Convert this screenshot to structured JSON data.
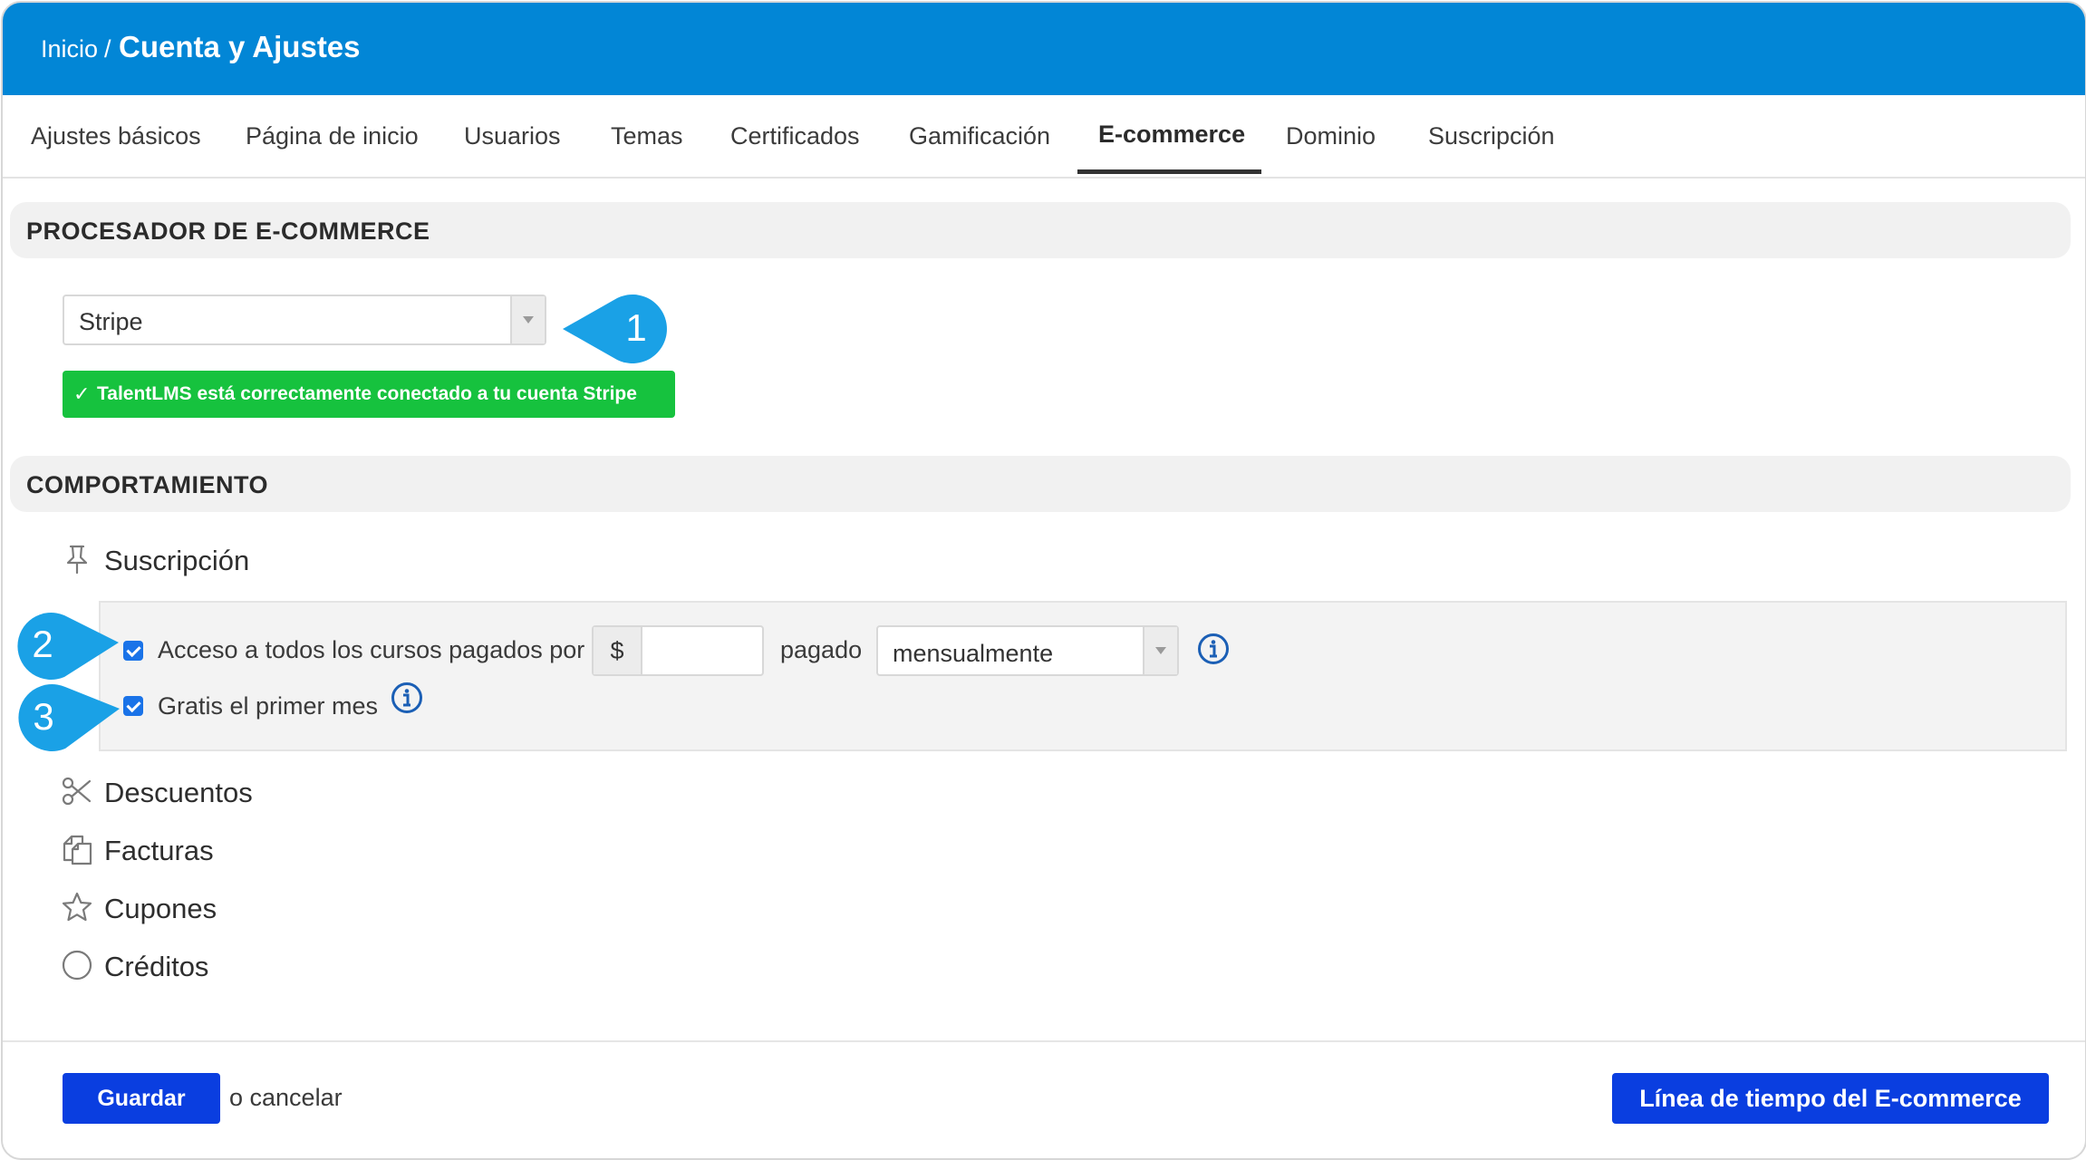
{
  "header": {
    "breadcrumb_home": "Inicio",
    "breadcrumb_sep": "/",
    "page_title": "Cuenta y Ajustes"
  },
  "tabs": [
    {
      "label": "Ajustes básicos"
    },
    {
      "label": "Página de inicio"
    },
    {
      "label": "Usuarios"
    },
    {
      "label": "Temas"
    },
    {
      "label": "Certificados"
    },
    {
      "label": "Gamificación"
    },
    {
      "label": "E-commerce",
      "active": true
    },
    {
      "label": "Dominio"
    },
    {
      "label": "Suscripción"
    }
  ],
  "processor": {
    "section_title": "PROCESADOR DE E-COMMERCE",
    "selected": "Stripe",
    "status_text": "TalentLMS está correctamente conectado a tu cuenta Stripe",
    "status_icon": "check-icon"
  },
  "behavior": {
    "section_title": "COMPORTAMIENTO",
    "subscription": {
      "label": "Suscripción",
      "icon": "pin-icon",
      "access_label": "Acceso a todos los cursos pagados por",
      "access_checked": true,
      "currency_symbol": "$",
      "amount_value": "",
      "paid_label": "pagado",
      "period_selected": "mensualmente",
      "free_month_label": "Gratis el primer mes",
      "free_month_checked": true
    },
    "items": [
      {
        "label": "Descuentos",
        "icon": "scissors-icon"
      },
      {
        "label": "Facturas",
        "icon": "invoices-icon"
      },
      {
        "label": "Cupones",
        "icon": "star-icon"
      },
      {
        "label": "Créditos",
        "icon": "circle-icon"
      }
    ]
  },
  "callouts": {
    "one": "1",
    "two": "2",
    "three": "3"
  },
  "footer": {
    "save_label": "Guardar",
    "cancel_text": "o cancelar",
    "timeline_label": "Línea de tiempo del E-commerce"
  },
  "colors": {
    "header": "#0286d6",
    "success": "#16c23e",
    "primary_button": "#0a3ee0",
    "callout": "#1aa1e6",
    "info_icon": "#1b5fb5"
  }
}
